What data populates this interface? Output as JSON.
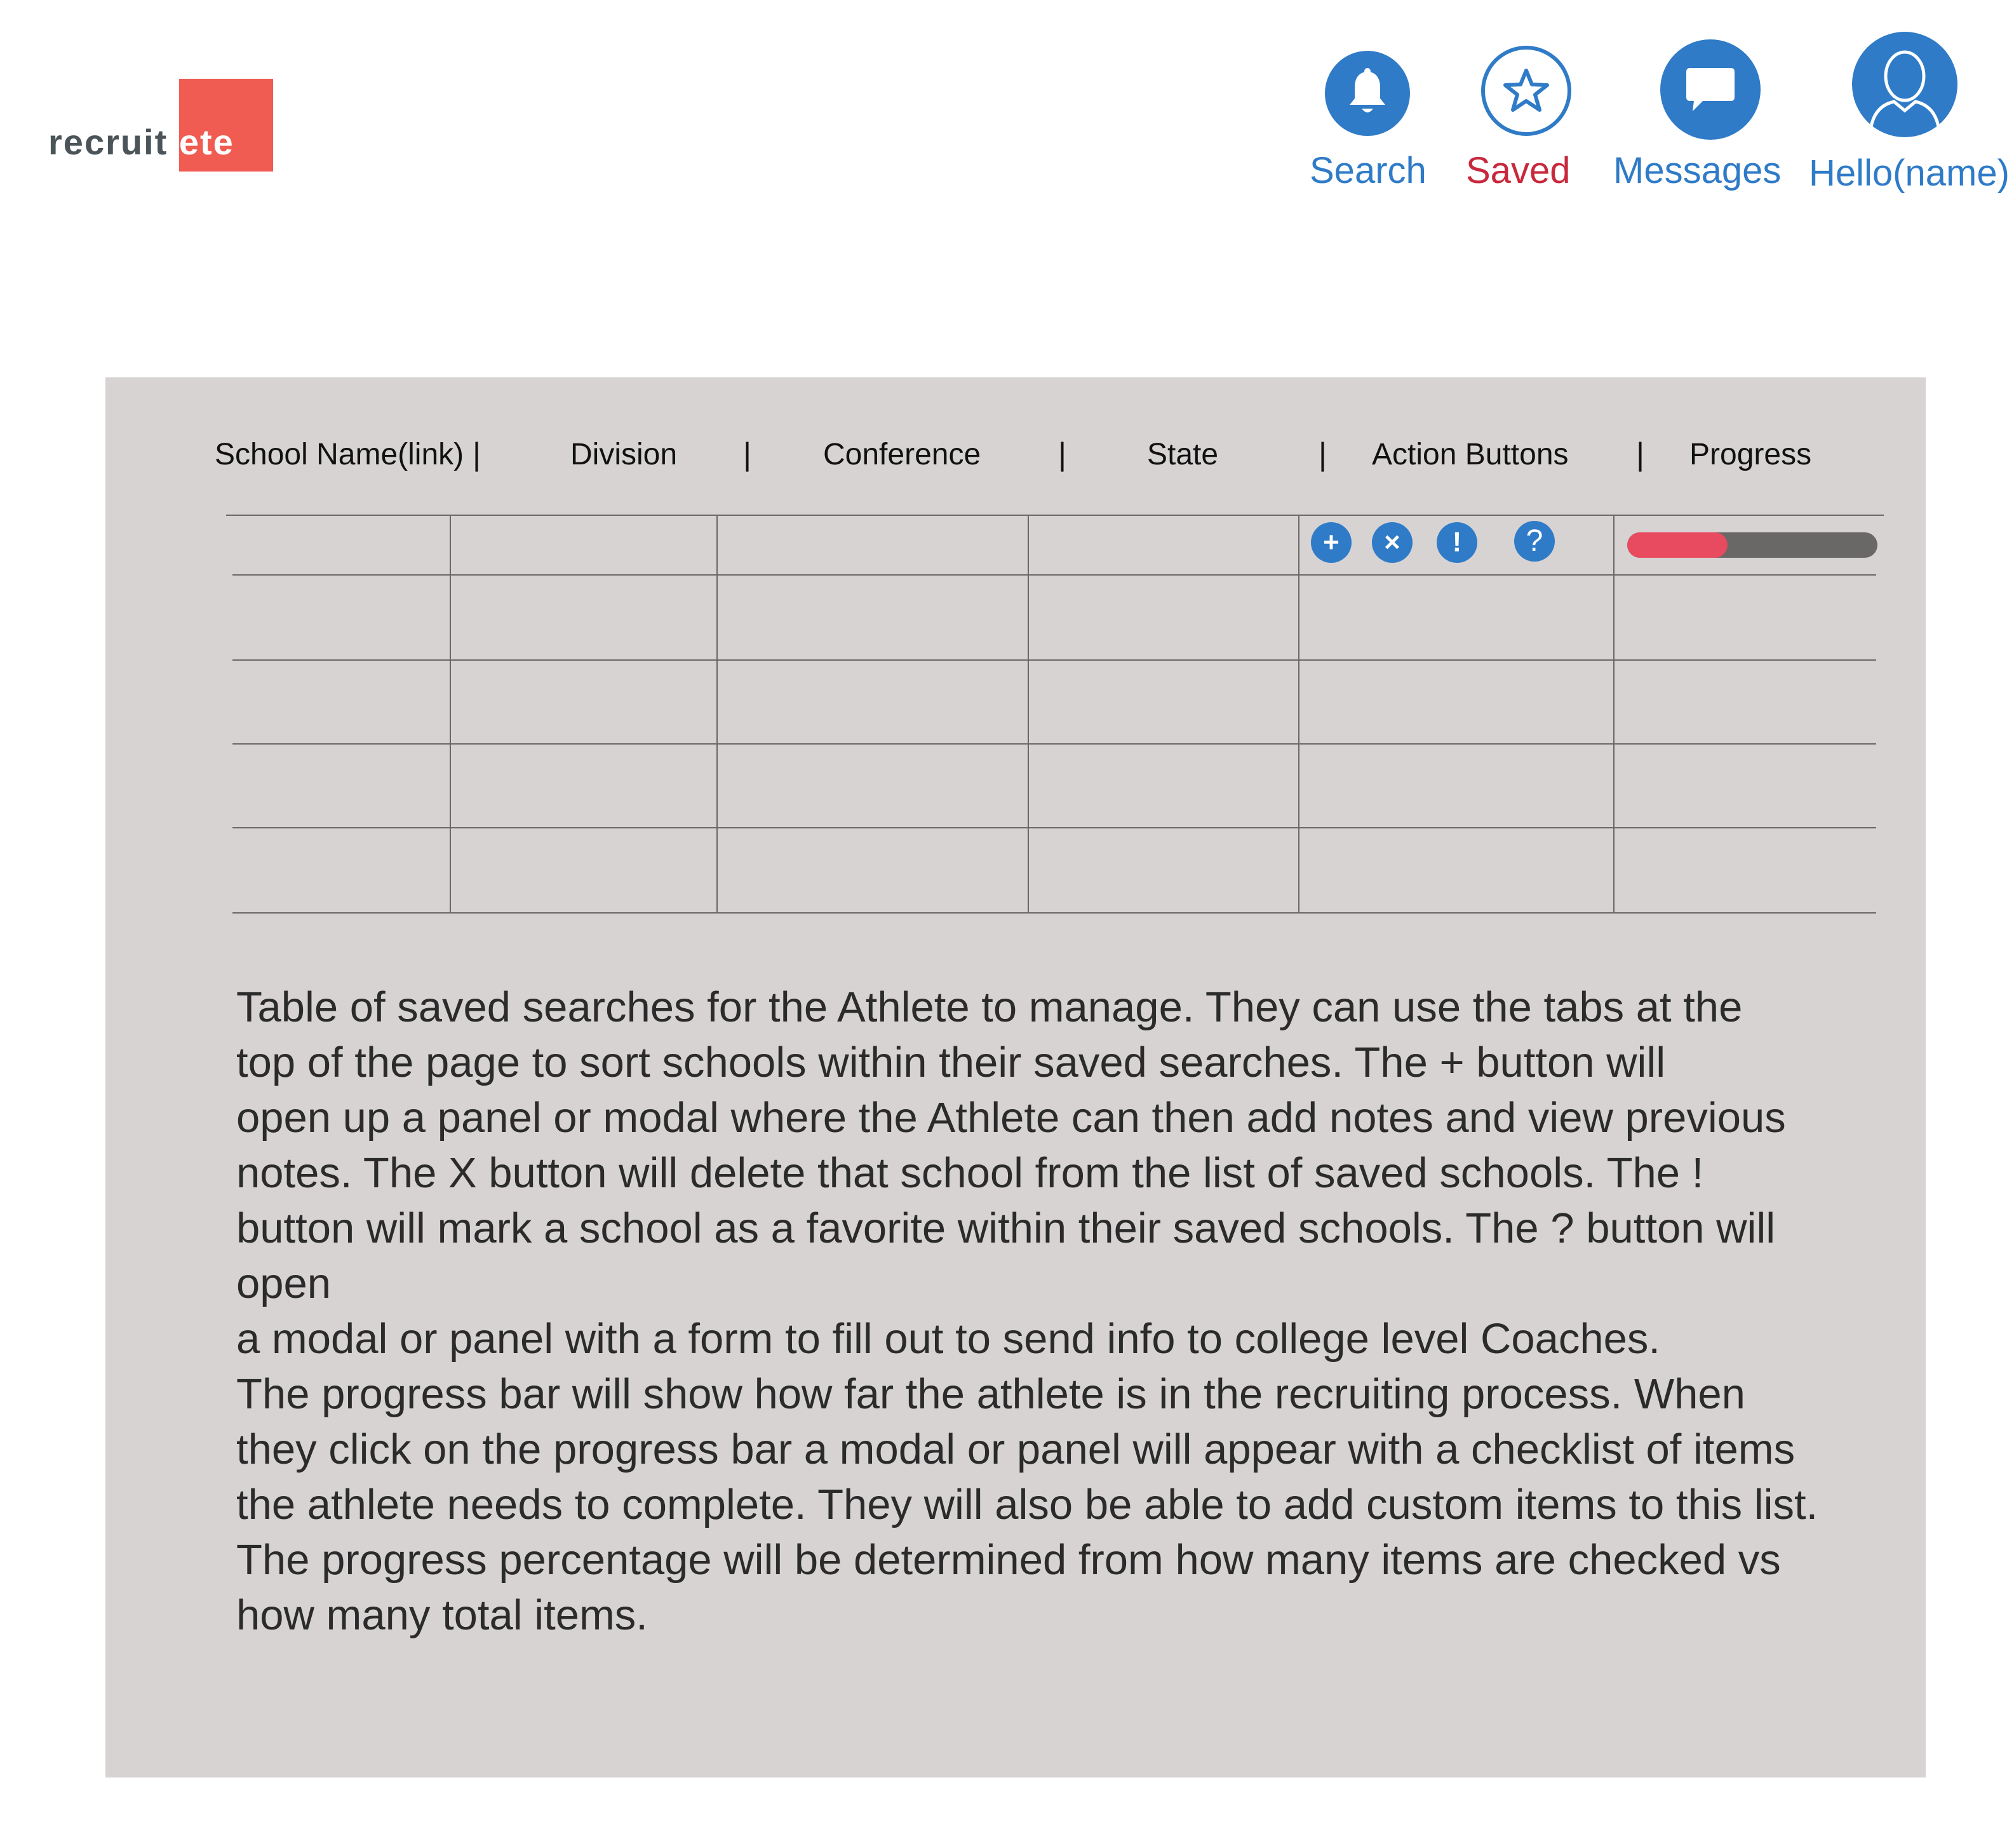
{
  "logo": {
    "part1": "recruit",
    "part2": "lete",
    "accent": "#f05b52"
  },
  "nav": {
    "search": {
      "label": "Search",
      "icon": "bell-icon"
    },
    "saved": {
      "label": "Saved",
      "icon": "star-icon"
    },
    "messages": {
      "label": "Messages",
      "icon": "chat-bubble-icon"
    },
    "profile": {
      "label": "Hello(name)",
      "icon": "user-icon"
    }
  },
  "colors": {
    "brand_blue": "#2f7bc7",
    "saved_red": "#c8283b",
    "progress_fill": "#e84a5f",
    "progress_track": "#6a6767",
    "panel_bg": "#d7d3d3"
  },
  "table": {
    "headers": [
      "School Name(link)",
      "Division",
      "Conference",
      "State",
      "Action Buttons",
      "Progress"
    ],
    "separator": "|",
    "rows": 5,
    "actions": [
      {
        "symbol": "+",
        "icon": "plus-icon"
      },
      {
        "symbol": "×",
        "icon": "close-icon"
      },
      {
        "symbol": "!",
        "icon": "exclamation-icon"
      },
      {
        "symbol": "?",
        "icon": "question-icon"
      }
    ],
    "progress_fraction": 0.4
  },
  "description": [
    "Table of saved searches for the Athlete to manage. They can use the tabs at the",
    "top of the page to sort schools within their saved searches.  The + button will",
    "open up a panel or modal where the Athlete can then add notes and view previous",
    "notes. The X button will delete that school from the list of saved schools.  The !",
    "button will mark a school as a favorite within their saved schools. The ? button will open",
    "a modal or panel with a form to fill out to send info to college level Coaches.",
    "The progress bar will show how far the athlete is in the recruiting process.  When",
    "they click on the progress bar a modal or panel will appear with a checklist of items",
    "the athlete needs to complete. They will also be able to add custom items to this list.",
    "The progress percentage will be determined from how many items are checked vs",
    "how many total items."
  ]
}
